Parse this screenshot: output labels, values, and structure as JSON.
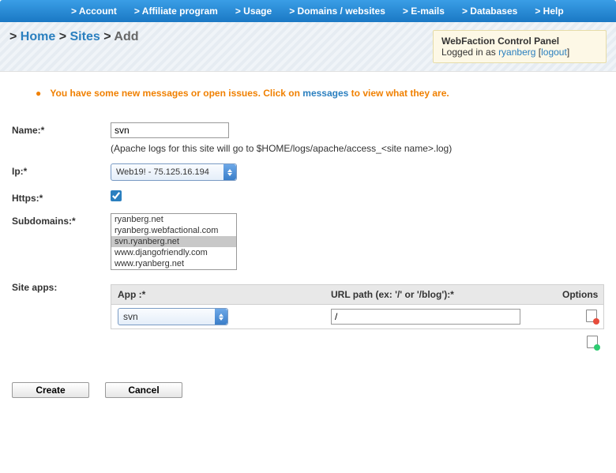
{
  "nav": {
    "account": "> Account",
    "affiliate": "> Affiliate program",
    "usage": "> Usage",
    "domains": "> Domains / websites",
    "emails": "> E-mails",
    "databases": "> Databases",
    "help": "> Help"
  },
  "breadcrumb": {
    "home": "Home",
    "sites": "Sites",
    "add": "Add"
  },
  "loginbox": {
    "title": "WebFaction Control Panel",
    "logged_in": "Logged in as ",
    "user": "ryanberg",
    "logout": "logout"
  },
  "notice": {
    "pre": "You have some new messages or open issues. Click on ",
    "link": "messages",
    "post": " to view what they are."
  },
  "labels": {
    "name": "Name:*",
    "ip": "Ip:*",
    "https": "Https:*",
    "subdomains": "Subdomains:*",
    "siteapps": "Site apps:"
  },
  "fields": {
    "name_value": "svn",
    "name_hint": "(Apache logs for this site will go to $HOME/logs/apache/access_<site name>.log)",
    "ip_value": "Web19! - 75.125.16.194",
    "https_checked": true,
    "subdomains": [
      "ryanberg.net",
      "ryanberg.webfactional.com",
      "svn.ryanberg.net",
      "www.djangofriendly.com",
      "www.ryanberg.net"
    ],
    "subdomain_selected": 2
  },
  "apps": {
    "head_app": "App :*",
    "head_url": "URL path (ex: '/' or '/blog'):*",
    "head_opt": "Options",
    "row": {
      "app_value": "svn",
      "url_value": "/"
    }
  },
  "buttons": {
    "create": "Create",
    "cancel": "Cancel"
  }
}
